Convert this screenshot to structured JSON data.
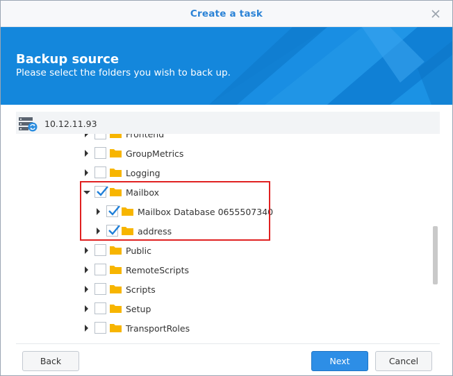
{
  "dialog": {
    "title": "Create a task"
  },
  "banner": {
    "title": "Backup source",
    "subtitle": "Please select the folders you wish to back up."
  },
  "tree": {
    "server": "10.12.11.93",
    "partial_item": "Frontend",
    "items": [
      {
        "label": "GroupMetrics",
        "checked": false,
        "expanded": false
      },
      {
        "label": "Logging",
        "checked": false,
        "expanded": false
      },
      {
        "label": "Mailbox",
        "checked": true,
        "expanded": true
      },
      {
        "label": "Mailbox Database 0655507340",
        "checked": true,
        "expanded": false
      },
      {
        "label": "address",
        "checked": true,
        "expanded": false
      },
      {
        "label": "Public",
        "checked": false,
        "expanded": false
      },
      {
        "label": "RemoteScripts",
        "checked": false,
        "expanded": false
      },
      {
        "label": "Scripts",
        "checked": false,
        "expanded": false
      },
      {
        "label": "Setup",
        "checked": false,
        "expanded": false
      },
      {
        "label": "TransportRoles",
        "checked": false,
        "expanded": false
      }
    ]
  },
  "footer": {
    "back_label": "Back",
    "next_label": "Next",
    "cancel_label": "Cancel"
  },
  "colors": {
    "accent": "#2a82d6",
    "banner": "#1487dc",
    "folder": "#f7b500",
    "highlight": "#e02020"
  }
}
